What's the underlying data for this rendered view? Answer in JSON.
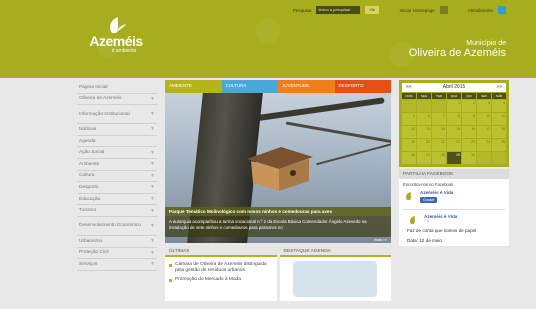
{
  "header": {
    "search_label": "Pesquisa",
    "search_placeholder": "termo a pesquisar",
    "search_button": "Ok",
    "homepage_label": "Iniciar Homepage",
    "service_label": "Atendimento",
    "logo_title": "Azeméis",
    "logo_subtitle": "é ambiente",
    "municipio_line1": "Município de",
    "municipio_line2": "Oliveira de Azeméis"
  },
  "sidebar": {
    "items": [
      {
        "label": "Página Inicial",
        "chevron": false
      },
      {
        "label": "Oliveira de Azeméis",
        "chevron": true
      },
      {
        "label": "Informação Institucional",
        "chevron": true
      },
      {
        "label": "Notícias",
        "chevron": true
      },
      {
        "label": "Agenda",
        "chevron": false
      },
      {
        "label": "Ação Social",
        "chevron": true
      },
      {
        "label": "Ambiente",
        "chevron": true
      },
      {
        "label": "Cultura",
        "chevron": true
      },
      {
        "label": "Desporto",
        "chevron": true
      },
      {
        "label": "Educação",
        "chevron": true
      },
      {
        "label": "Turismo",
        "chevron": true
      },
      {
        "label": "Desenvolvimento Económico",
        "chevron": true
      },
      {
        "label": "Urbanismo",
        "chevron": true
      },
      {
        "label": "Proteção Civil",
        "chevron": true
      },
      {
        "label": "Serviços",
        "chevron": true
      }
    ]
  },
  "tabs": [
    {
      "label": "AMBIENTE",
      "color": "#b4b51d"
    },
    {
      "label": "CULTURA",
      "color": "#49a8d8"
    },
    {
      "label": "JUVENTUDE",
      "color": "#f07f1a"
    },
    {
      "label": "DESPORTO",
      "color": "#e84e18"
    }
  ],
  "feature": {
    "title": "Parque Temático Molinológico com novos ninhos e comedouras para aves",
    "description": "A autarquia acompanhou a turma vocacional n.º 2 da Escola Básica Comendador Ângelo Azevedo na instalação de sete ninhos e comedouros para pássaros no",
    "more": "mais >>"
  },
  "news": {
    "header": "ÚLTIMAS",
    "items": [
      {
        "text": "Câmara de Oliveira de Azeméis distinguida pela gestão de resíduos urbanos"
      },
      {
        "text": "Promoção do Mercado à Moda"
      }
    ]
  },
  "agenda": {
    "header": "DESTAQUE AGENDA"
  },
  "calendar": {
    "month": "Abril 2015",
    "prev": "««",
    "next": "»»",
    "day_names": [
      "DOM",
      "SEG",
      "TER",
      "QUA",
      "QUI",
      "SEX",
      "SÁB"
    ],
    "days": [
      "",
      "",
      "",
      "1",
      "2",
      "3",
      "4",
      "5",
      "6",
      "7",
      "8",
      "9",
      "10",
      "11",
      "12",
      "13",
      "14",
      "15",
      "16",
      "17",
      "18",
      "19",
      "20",
      "21",
      "22",
      "23",
      "24",
      "25",
      "26",
      "27",
      "28",
      "29",
      "30",
      "",
      ""
    ],
    "today": "29"
  },
  "facebook": {
    "header": "PARTILHA FACEBOOK",
    "find_us": "Encontra-nos no Facebook",
    "page_name": "Azeméis é Vida",
    "like_button": "Gostar",
    "post_page_name": "Azeméis é Vida",
    "post_time": "7 h",
    "post_text": "Faz de conta que somos de papel",
    "post_date": "Data: 12 de maio"
  }
}
